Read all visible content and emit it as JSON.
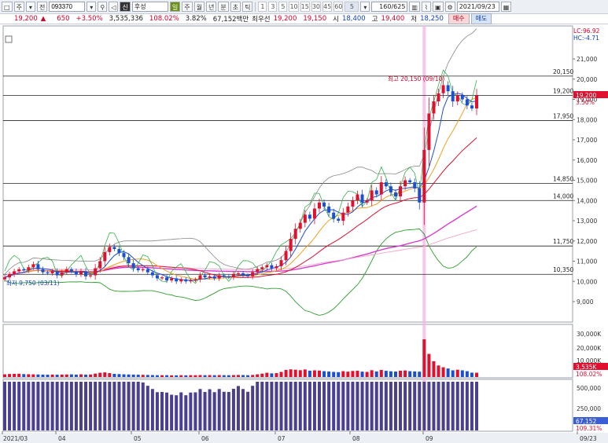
{
  "toolbar": {
    "chart_type": "주",
    "stock_scope": "전",
    "code": "093370",
    "name": "후성",
    "flag_label": "신",
    "period_buttons": [
      "주",
      "월",
      "년",
      "분",
      "초",
      "틱"
    ],
    "minute_options": [
      "1",
      "3",
      "5",
      "10",
      "15",
      "30",
      "45",
      "60"
    ],
    "count_option": "5",
    "count_display": "160/625",
    "date": "2021/09/23"
  },
  "quote": {
    "price": "19,200",
    "change": "650",
    "change_pct": "+3.50%",
    "volume": "3,535,336",
    "volume_ratio": "108.02%",
    "turnover_pct": "3.82%",
    "trade_value": "67,152백만",
    "priority_label": "최우선",
    "best_ask": "19,200",
    "best_bid": "19,150",
    "open_label": "시",
    "open": "18,400",
    "high_label": "고",
    "high": "19,400",
    "low_label": "저",
    "low": "18,250",
    "buy_label": "매수",
    "sell_label": "매도"
  },
  "chart": {
    "lc_label": "LC:96.92",
    "hc_label": "HC:-4.71",
    "high_annotation": "최고 20,150 (09/10)",
    "low_annotation": "최저 9,750 (03/11)",
    "price_badge": "19,200",
    "price_badge_pct": "3.50%",
    "volume_badge": "3,535K",
    "volume_badge_pct": "108.02%",
    "value_badge": "67,152",
    "value_badge_pct": "109.31%",
    "colors": {
      "up": "#e0102e",
      "down": "#1d4fd1",
      "highlight": "#f5b3e6"
    }
  },
  "chart_data": {
    "type": "candlestick",
    "symbol": "093370",
    "period": "daily",
    "y_ticks": [
      9000,
      10000,
      11000,
      12000,
      13000,
      14000,
      15000,
      16000,
      17000,
      18000,
      19000,
      20000,
      21000
    ],
    "y_tick_labels": [
      "9,000",
      "10,000",
      "11,000",
      "12,000",
      "13,000",
      "14,000",
      "15,000",
      "16,000",
      "17,000",
      "18,000",
      "19,000",
      "20,000",
      "21,000"
    ],
    "horizontal_levels": [
      20150,
      19200,
      17950,
      14850,
      14000,
      11750,
      10350
    ],
    "horizontal_level_labels": [
      "20,150",
      "19,200",
      "17,950",
      "14,850",
      "14,000",
      "11,750",
      "10,350"
    ],
    "x_labels": [
      "2021/03",
      "04",
      "05",
      "06",
      "07",
      "08",
      "09",
      "09/23"
    ],
    "volume_ticks": [
      "30,000K",
      "20,000K",
      "10,000K"
    ],
    "value_ticks": [
      "500,000",
      "250,000"
    ],
    "closes": [
      10200,
      10350,
      10500,
      10600,
      10550,
      10700,
      10850,
      10600,
      10450,
      10400,
      10500,
      10300,
      10450,
      10600,
      10500,
      10350,
      10500,
      10250,
      10300,
      10650,
      11000,
      11450,
      11700,
      11600,
      11400,
      11200,
      10900,
      10650,
      10550,
      10600,
      10450,
      10300,
      10150,
      10200,
      10050,
      10150,
      10000,
      10100,
      10000,
      10050,
      10100,
      10300,
      10200,
      10250,
      10150,
      10300,
      10250,
      10200,
      10350,
      10400,
      10300,
      10250,
      10450,
      10600,
      10700,
      10800,
      10650,
      10750,
      11050,
      11500,
      12100,
      12600,
      12900,
      13300,
      13100,
      13600,
      13900,
      13700,
      13400,
      13100,
      13000,
      13400,
      13700,
      14000,
      14300,
      13900,
      14000,
      14500,
      14300,
      14900,
      14700,
      14400,
      14200,
      14700,
      15000,
      14900,
      14600,
      13900,
      16500,
      18300,
      18900,
      19300,
      19700,
      19400,
      18900,
      19200,
      19000,
      18700,
      18550,
      19200
    ],
    "volumes_k": [
      2200,
      2500,
      2600,
      2700,
      2400,
      2300,
      2200,
      2100,
      2000,
      1900,
      2000,
      1900,
      2000,
      2100,
      2200,
      2000,
      2200,
      2000,
      2100,
      2800,
      3500,
      3800,
      3200,
      2600,
      2400,
      2200,
      2100,
      2000,
      1900,
      1800,
      1700,
      1600,
      1500,
      1500,
      1500,
      1400,
      1400,
      1500,
      1400,
      1500,
      1500,
      1600,
      1500,
      1600,
      1500,
      1600,
      1500,
      1500,
      1600,
      1700,
      1600,
      1500,
      1700,
      2200,
      2800,
      3500,
      3000,
      3200,
      4200,
      5800,
      6300,
      6000,
      5600,
      6200,
      5200,
      5500,
      5300,
      4800,
      4500,
      4200,
      4000,
      4800,
      4400,
      5000,
      5200,
      4400,
      4200,
      5600,
      4600,
      5800,
      5100,
      4700,
      4500,
      5200,
      5400,
      4800,
      4600,
      4400,
      31000,
      19000,
      13000,
      9500,
      8000,
      7000,
      5500,
      6000,
      5500,
      4800,
      3600,
      3500
    ]
  }
}
